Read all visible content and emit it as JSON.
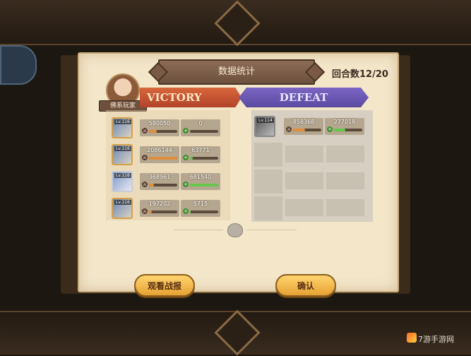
{
  "header": {
    "title": "数据统计",
    "rounds": "回合数12/20"
  },
  "player": {
    "name": "佛系玩家"
  },
  "results": {
    "victory_label": "VICTORY",
    "defeat_label": "DEFEAT"
  },
  "victory_team": [
    {
      "level": "Lv.116",
      "damage": "580050",
      "heal": "0",
      "damage_frac": 0.28,
      "heal_frac": 0.0
    },
    {
      "level": "Lv.116",
      "damage": "2086144",
      "heal": "63771",
      "damage_frac": 1.0,
      "heal_frac": 0.1
    },
    {
      "level": "Lv.116",
      "damage": "368961",
      "heal": "681540",
      "damage_frac": 0.18,
      "heal_frac": 1.0
    },
    {
      "level": "Lv.116",
      "damage": "197202",
      "heal": "5715",
      "damage_frac": 0.1,
      "heal_frac": 0.01
    }
  ],
  "defeat_team": [
    {
      "level": "Lv.114",
      "damage": "858368",
      "heal": "277018",
      "damage_frac": 0.42,
      "heal_frac": 0.4
    }
  ],
  "buttons": {
    "watch_replay": "观看战报",
    "confirm": "确认"
  },
  "watermark": "7游手游网",
  "icons": {
    "damage": "sword-icon",
    "heal": "plus-icon",
    "bag": "bag-icon"
  }
}
